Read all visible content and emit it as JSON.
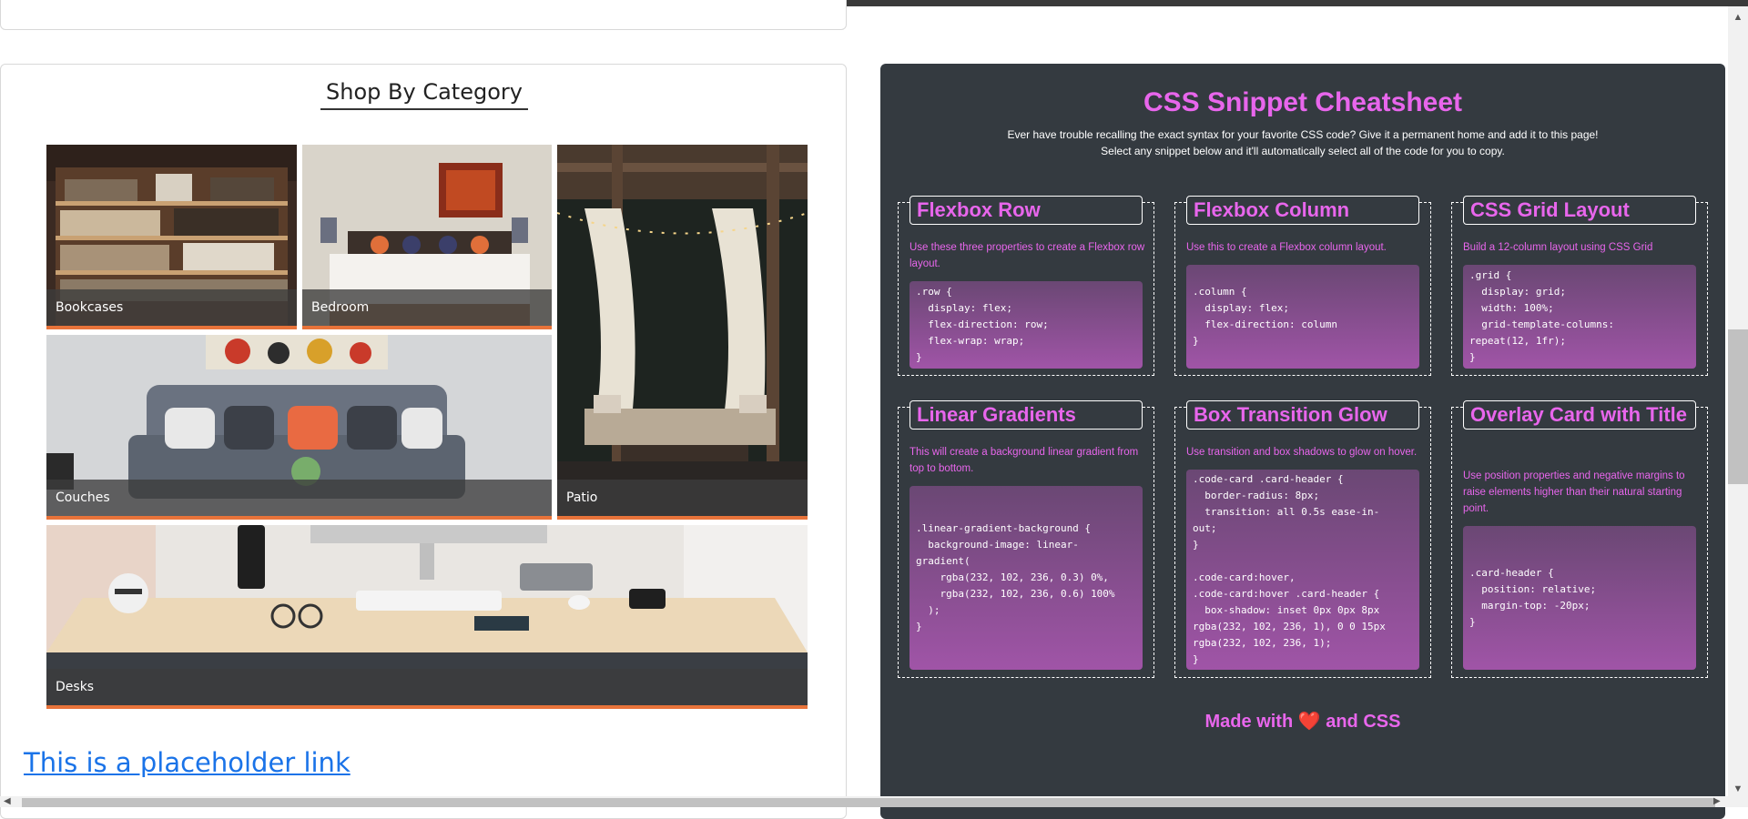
{
  "shop": {
    "title": "Shop By Category",
    "categories": [
      {
        "label": "Bookcases"
      },
      {
        "label": "Bedroom"
      },
      {
        "label": "Patio"
      },
      {
        "label": "Couches"
      },
      {
        "label": "Desks"
      }
    ],
    "placeholder_link": "This is a placeholder link"
  },
  "cheatsheet": {
    "title": "CSS Snippet Cheatsheet",
    "intro": "Ever have trouble recalling the exact syntax for your favorite CSS code? Give it a permanent home and add it to this page! Select any snippet below and it'll automatically select all of the code for you to copy.",
    "snippets": [
      {
        "title": "Flexbox Row",
        "description": "Use these three properties to create a Flexbox row layout.",
        "code": ".row {\n  display: flex;\n  flex-direction: row;\n  flex-wrap: wrap;\n}"
      },
      {
        "title": "Flexbox Column",
        "description": "Use this to create a Flexbox column layout.",
        "code": ".column {\n  display: flex;\n  flex-direction: column\n}"
      },
      {
        "title": "CSS Grid Layout",
        "description": "Build a 12-column layout using CSS Grid",
        "code": ".grid {\n  display: grid;\n  width: 100%;\n  grid-template-columns:\nrepeat(12, 1fr);\n}"
      },
      {
        "title": "Linear Gradients",
        "description": "This will create a background linear gradient from top to bottom.",
        "code": ".linear-gradient-background {\n  background-image: linear-\ngradient(\n    rgba(232, 102, 236, 0.3) 0%,\n    rgba(232, 102, 236, 0.6) 100%\n  );\n}"
      },
      {
        "title": "Box Transition Glow",
        "description": "Use transition and box shadows to glow on hover.",
        "code": ".code-card .card-header {\n  border-radius: 8px;\n  transition: all 0.5s ease-in-\nout;\n}\n\n.code-card:hover,\n.code-card:hover .card-header {\n  box-shadow: inset 0px 0px 8px\nrgba(232, 102, 236, 1), 0 0 15px\nrgba(232, 102, 236, 1);\n}"
      },
      {
        "title": "Overlay Card with Title",
        "description": "Use position properties and negative margins to raise elements higher than their natural starting point.",
        "code": ".card-header {\n  position: relative;\n  margin-top: -20px;\n}"
      }
    ],
    "footer": {
      "prefix": "Made with",
      "heart": "❤️",
      "suffix": "and CSS"
    }
  },
  "colors": {
    "accent": "#e866ec",
    "panel_bg": "#343a40",
    "tile_border": "#e8733a",
    "link": "#1a73e8"
  }
}
